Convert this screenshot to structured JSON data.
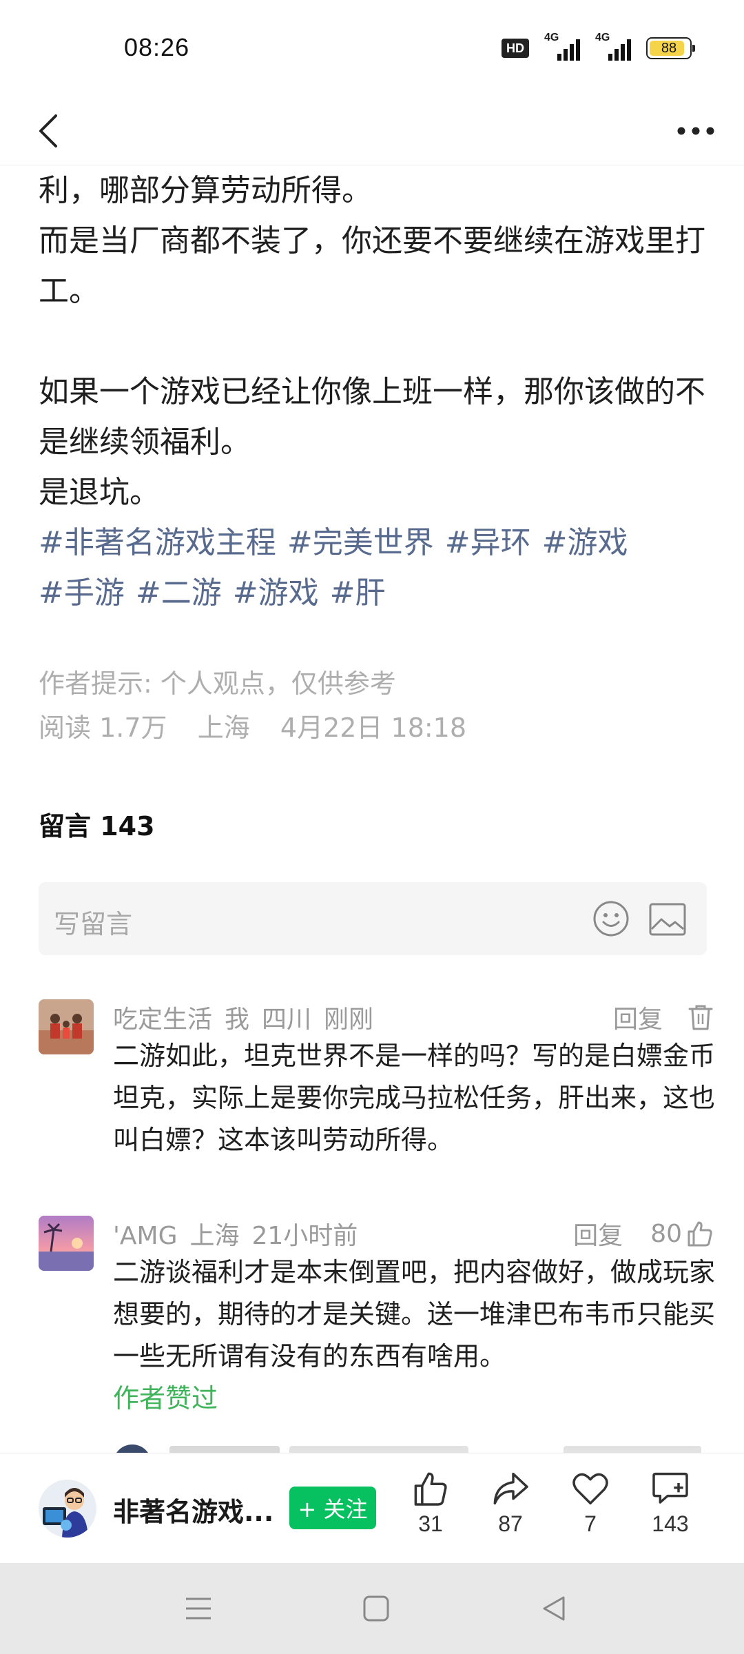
{
  "status_bar": {
    "time": "08:26",
    "hd_label": "HD",
    "network_1": "4G",
    "network_2": "4G",
    "battery": "88"
  },
  "nav": {
    "back_icon": "chevron-left-icon",
    "more_icon": "more-horizontal-icon"
  },
  "article": {
    "paragraphs": [
      "利，哪部分算劳动所得。",
      "而是当厂商都不装了，你还要不要继续在游戏里打工。",
      "",
      "如果一个游戏已经让你像上班一样，那你该做的不是继续领福利。",
      "是退坑。"
    ],
    "tags": [
      "#非著名游戏主程",
      "#完美世界",
      "#异环",
      "#游戏",
      "#手游",
      "#二游",
      "#游戏",
      "#肝"
    ],
    "author_note": "作者提示: 个人观点，仅供参考",
    "reads": "阅读 1.7万",
    "location": "上海",
    "datetime": "4月22日 18:18"
  },
  "comments_section": {
    "title": "留言 143",
    "input_placeholder": "写留言"
  },
  "comments": [
    {
      "user": "吃定生活",
      "tag": "我",
      "location": "四川",
      "time": "刚刚",
      "reply": "回复",
      "text": "二游如此，坦克世界不是一样的吗？写的是白嫖金币坦克，实际上是要你完成马拉松任务，肝出来，这也叫白嫖？这本该叫劳动所得。"
    },
    {
      "user": "'AMG",
      "location": "上海",
      "time": "21小时前",
      "reply": "回复",
      "likes": "80",
      "text": "二游谈福利才是本末倒置吧，把内容做好，做成玩家想要的，期待的才是关键。送一堆津巴布韦币只能买一些无所谓有没有的东西有啥用。",
      "author_liked": "作者赞过"
    }
  ],
  "bottom_bar": {
    "author_name": "非著名游戏...",
    "follow": "+ 关注",
    "like_count": "31",
    "share_count": "87",
    "favorite_count": "7",
    "comment_count": "143"
  },
  "colors": {
    "tag": "#586b8f",
    "follow_button": "#07c160",
    "author_liked": "#3fb45a",
    "meta": "#aeaeae"
  }
}
